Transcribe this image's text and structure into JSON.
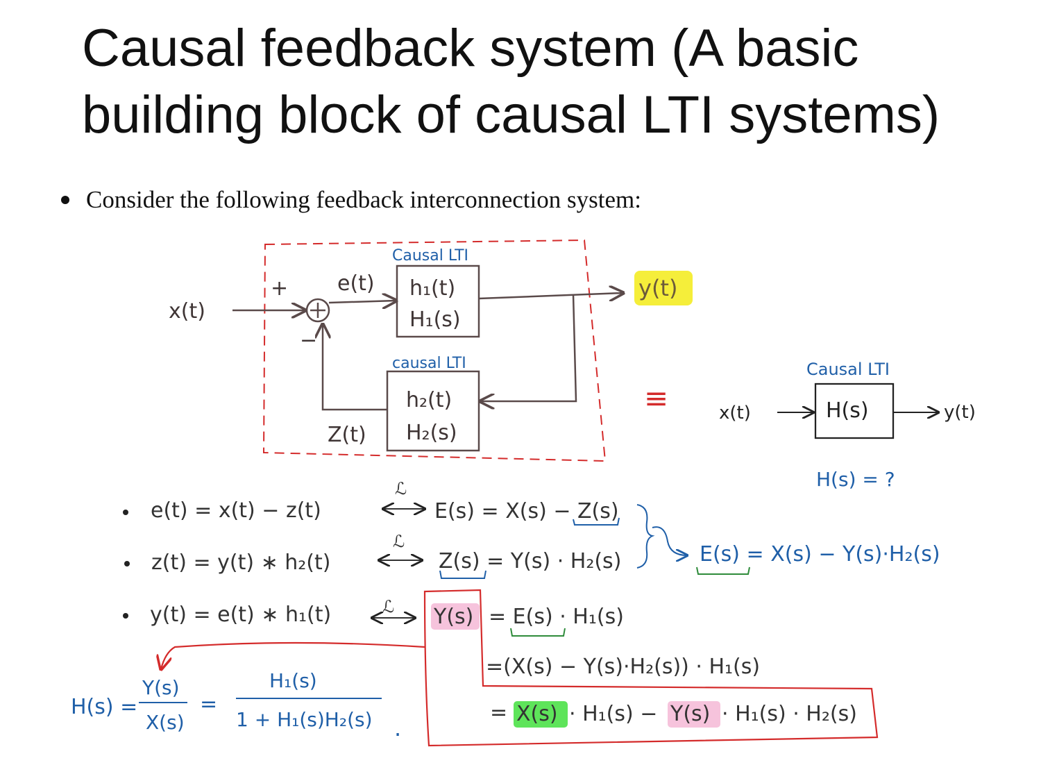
{
  "slide": {
    "title": "Causal feedback system (A basic building block of causal LTI systems)",
    "bullet": "Consider the following feedback interconnection system:"
  },
  "diagram": {
    "top_block_label": "Causal LTI",
    "top_block_line1": "h₁(t)",
    "top_block_line2": "H₁(s)",
    "bottom_block_label": "causal LTI",
    "bottom_block_line1": "h₂(t)",
    "bottom_block_line2": "H₂(s)",
    "input": "x(t)",
    "plus_sign": "+",
    "minus_sign": "−",
    "error": "e(t)",
    "output": "y(t)",
    "feedback": "Z(t)",
    "equiv": "≡",
    "eq_block_label": "Causal LTI",
    "eq_block_text": "H(s)",
    "eq_input": "x(t)",
    "eq_output": "y(t)",
    "question": "H(s) = ?"
  },
  "equations": {
    "transform_symbol": "ℒ",
    "eq1_time": "e(t) = x(t) − z(t)",
    "eq1_freq": "E(s) = X(s) − Z(s)",
    "eq2_time": "z(t) = y(t) ∗ h₂(t)",
    "eq2_freq": "Z(s) = Y(s) · H₂(s)",
    "eq3_time": "y(t) = e(t) ∗ h₁(t)",
    "eq3_lhs": "Y(s)",
    "eq3_rhs": "= E(s) · H₁(s)",
    "combined": "E(s) = X(s) − Y(s)·H₂(s)",
    "step2": "=(X(s) − Y(s)·H₂(s)) · H₁(s)",
    "step3_eq": "=",
    "step3_x": "X(s)",
    "step3_mid": "· H₁(s) −",
    "step3_y": "Y(s)",
    "step3_end": "· H₁(s) · H₂(s)",
    "result_lhs": "H(s) =",
    "result_num1": "Y(s)",
    "result_den1": "X(s)",
    "result_eq": "=",
    "result_num2": "H₁(s)",
    "result_den2": "1 + H₁(s)H₂(s)",
    "result_period": "."
  },
  "colors": {
    "ink": "#5a4a4a",
    "blue": "#1f5fa8",
    "red": "#d42b2b",
    "yellow_highlight": "#f5ee3a",
    "pink_highlight": "#f6c3dc",
    "green_highlight": "#5ee45a",
    "green_underline": "#2e8b3a"
  }
}
